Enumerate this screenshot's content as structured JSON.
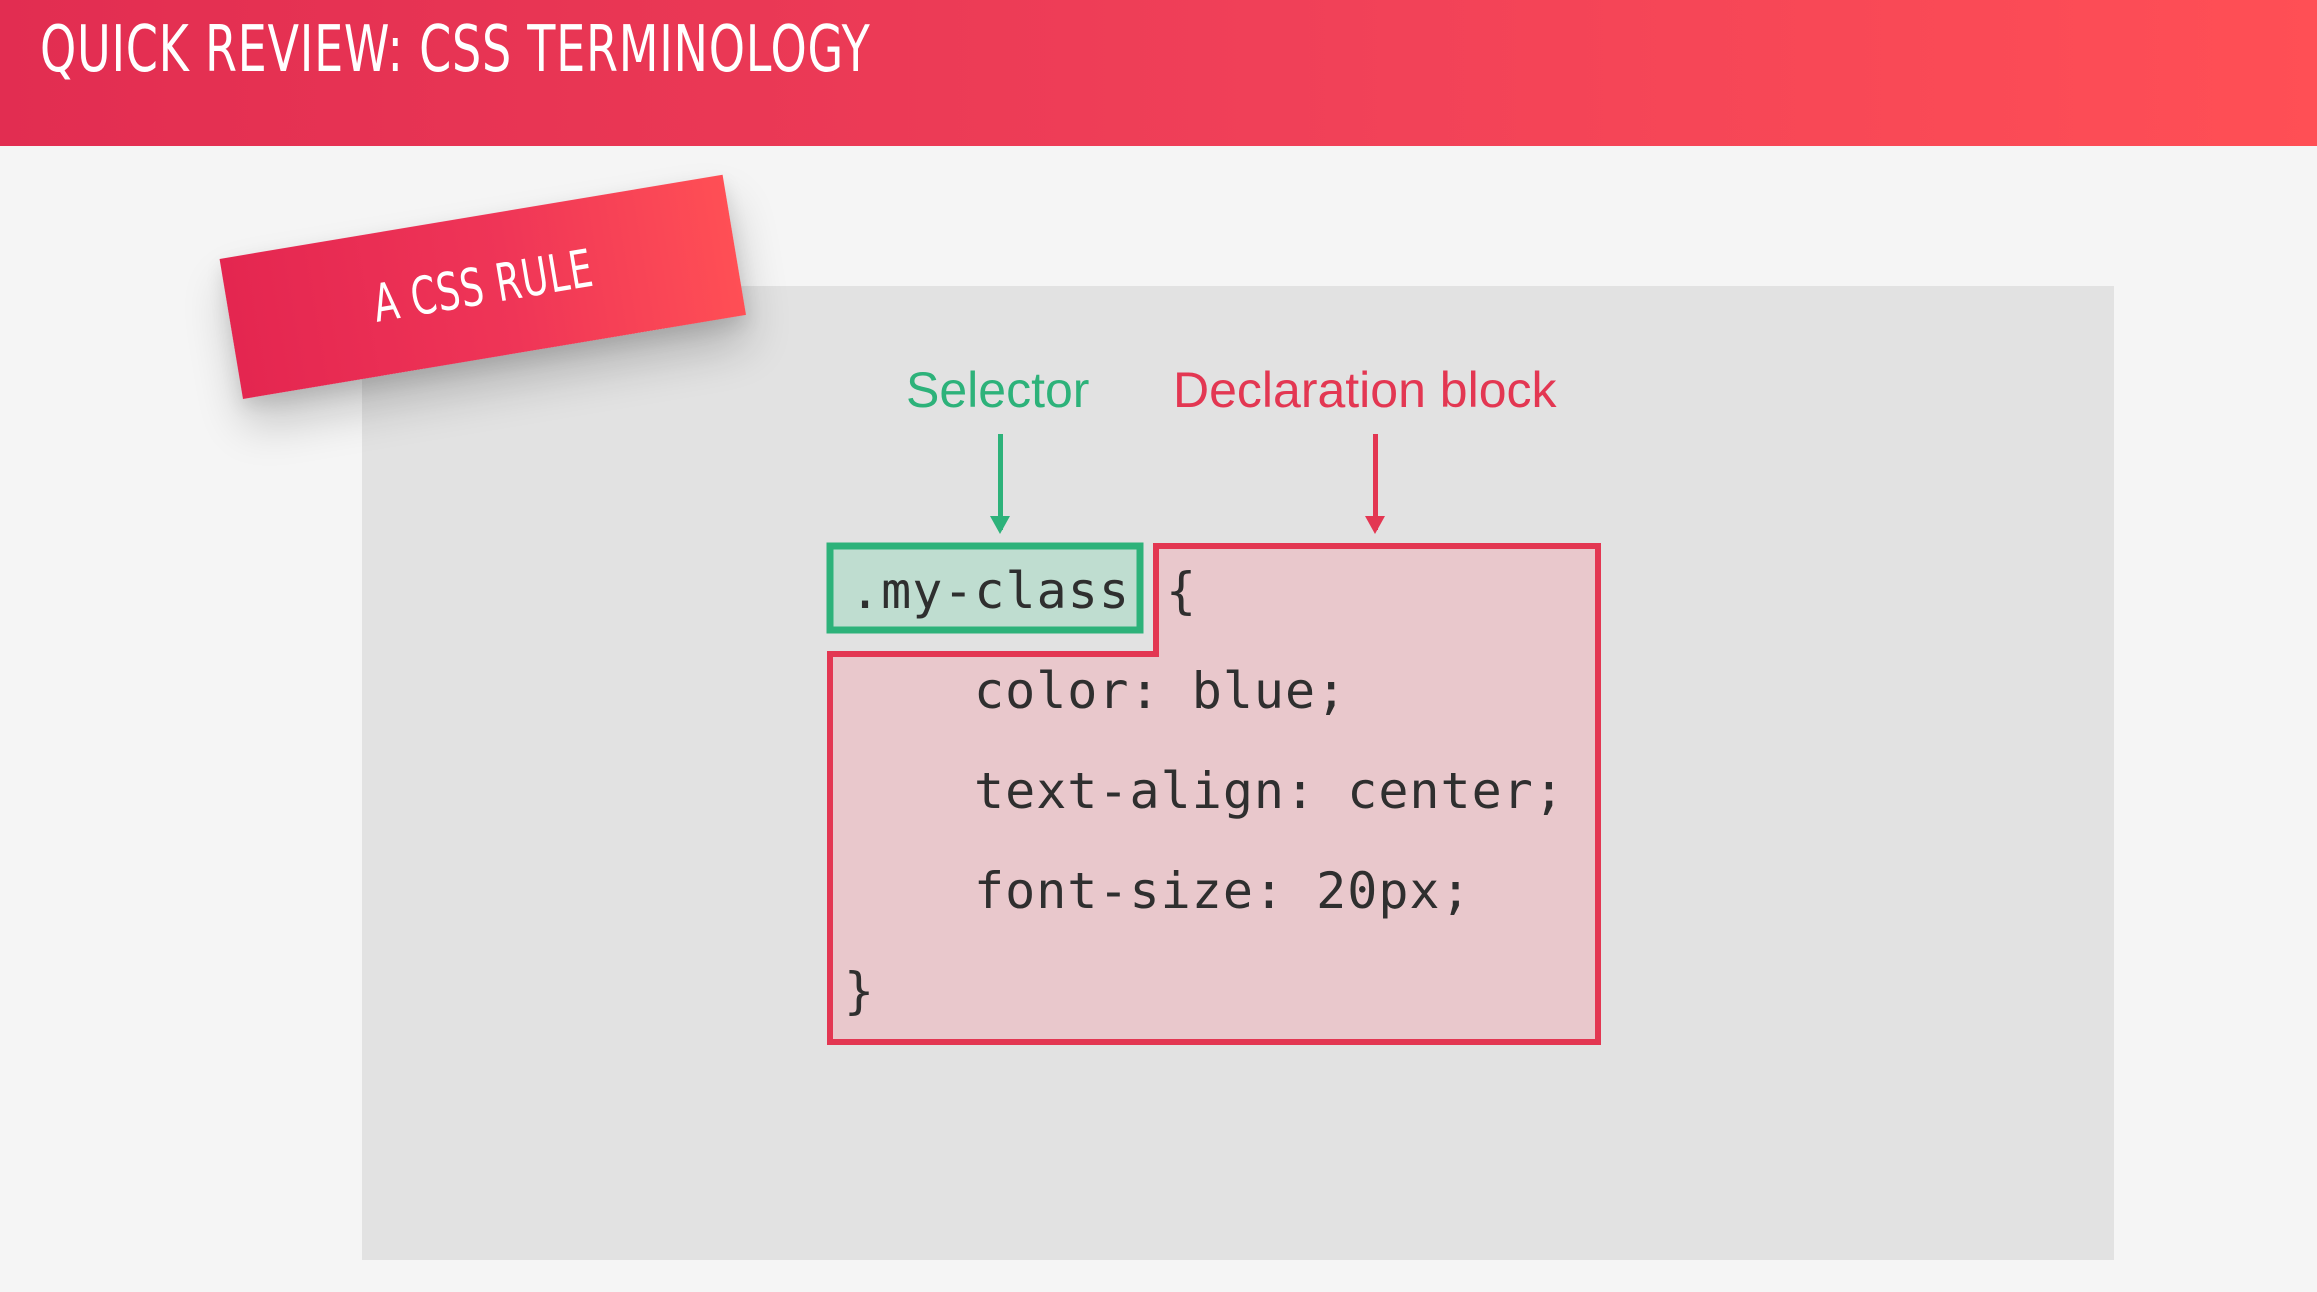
{
  "header": {
    "title": "QUICK REVIEW: CSS TERMINOLOGY"
  },
  "tag": {
    "label": "A CSS RULE"
  },
  "labels": {
    "selector": "Selector",
    "declaration_block": "Declaration block"
  },
  "code": {
    "selector": ".my-class",
    "open_brace": "{",
    "declarations": [
      "color: blue;",
      "text-align: center;",
      "font-size: 20px;"
    ],
    "close_brace": "}"
  },
  "colors": {
    "header_start": "#e22d51",
    "header_end": "#ff4f55",
    "selector": "#2db27a",
    "selector_fill": "#bfddd0",
    "declaration": "#e33752",
    "declaration_fill": "#e9c8cc",
    "panel": "#e2e2e2",
    "background": "#f5f5f5"
  },
  "icons": [
    "selector-arrow-icon",
    "declaration-arrow-icon"
  ]
}
